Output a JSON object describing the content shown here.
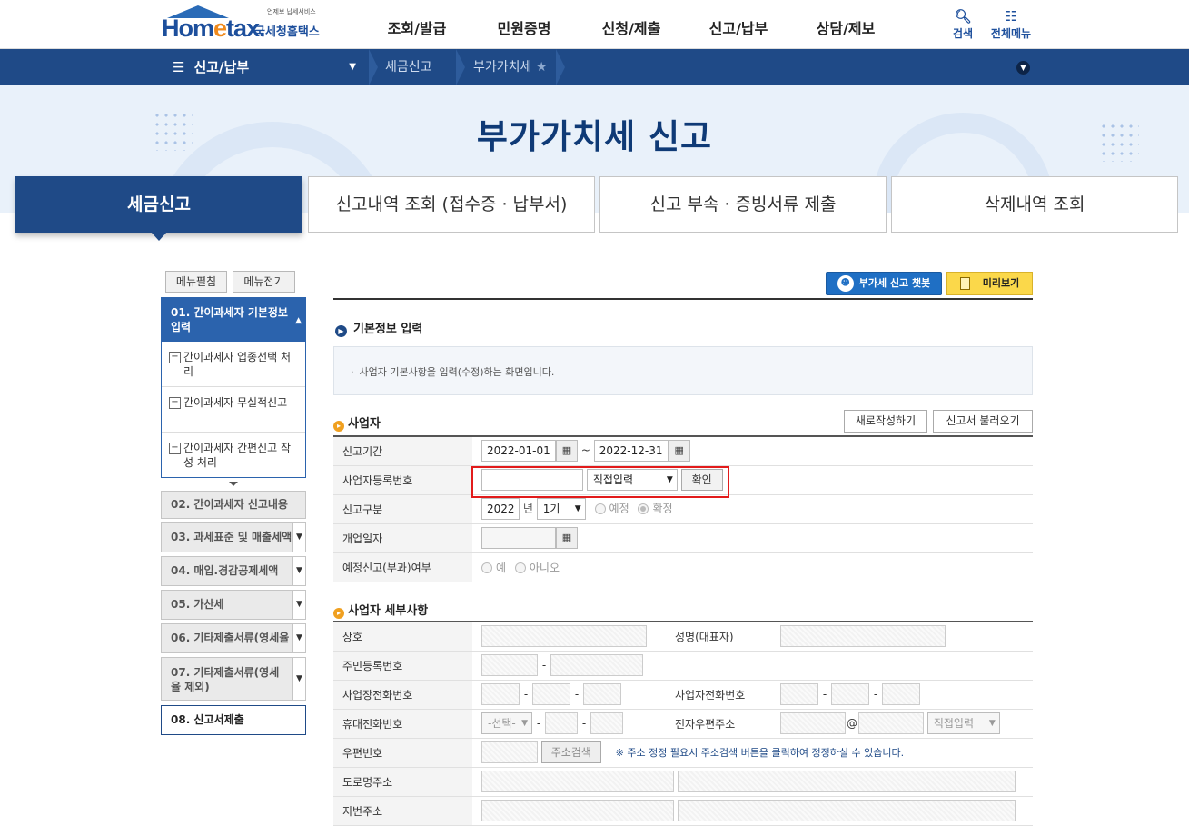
{
  "header": {
    "logo_tagline": "언제보 납세서비스",
    "logo_brand_pre": "Hom",
    "logo_brand_e": "e",
    "logo_brand_post": "tax.",
    "logo_sub": "국세청홈택스",
    "gnb": [
      "조회/발급",
      "민원증명",
      "신청/제출",
      "신고/납부",
      "상담/제보"
    ],
    "search_label": "검색",
    "allmenu_label": "전체메뉴"
  },
  "nav": {
    "current_menu": "신고/납부",
    "crumb1": "세금신고",
    "crumb2": "부가가치세"
  },
  "hero": {
    "title": "부가가치세 신고"
  },
  "tabs": [
    "세금신고",
    "신고내역 조회 (접수증 · 납부서)",
    "신고 부속 · 증빙서류 제출",
    "삭제내역 조회"
  ],
  "side": {
    "expand_label": "메뉴펼침",
    "collapse_label": "메뉴접기",
    "step1_title": "01. 간이과세자 기본정보 입력",
    "step1_items": [
      "간이과세자 업종선택 처리",
      "간이과세자 무실적신고",
      "간이과세자 간편신고 작성 처리"
    ],
    "steps": [
      "02. 간이과세자 신고내용",
      "03. 과세표준 및 매출세액",
      "04. 매입.경감공제세액",
      "05. 가산세",
      "06. 기타제출서류(영세율",
      "07. 기타제출서류(영세율 제외)",
      "08. 신고서제출"
    ]
  },
  "content": {
    "chatbot_label": "부가세 신고 챗봇",
    "preview_label": "미리보기",
    "section_title": "기본정보 입력",
    "info_text": "사업자 기본사항을 입력(수정)하는 화면입니다.",
    "biz_title": "사업자",
    "new_btn": "새로작성하기",
    "load_btn": "신고서 불러오기",
    "rows": {
      "period_label": "신고기간",
      "period_from": "2022-01-01",
      "period_tilde": "~",
      "period_to": "2022-12-31",
      "bizno_label": "사업자등록번호",
      "bizno_value": "",
      "bizno_select": "직접입력",
      "confirm_btn": "확인",
      "type_label": "신고구분",
      "year": "2022",
      "year_unit": "년",
      "term": "1기",
      "radio_pre": "예정",
      "radio_final": "확정",
      "open_label": "개업일자",
      "open_value": "",
      "pre_label": "예정신고(부과)여부",
      "yes": "예",
      "no": "아니오"
    },
    "detail_title": "사업자 세부사항",
    "detail": {
      "name_label": "상호",
      "rep_label": "성명(대표자)",
      "rrn_label": "주민등록번호",
      "shop_tel_label": "사업장전화번호",
      "biz_tel_label": "사업자전화번호",
      "mobile_label": "휴대전화번호",
      "mobile_select": "-선택-",
      "email_label": "전자우편주소",
      "at": "@",
      "email_select": "직접입력",
      "zip_label": "우편번호",
      "addr_search_btn": "주소검색",
      "zip_note": "※ 주소 정정 필요시 주소검색 버튼을 클릭하여 정정하실 수 있습니다.",
      "road_label": "도로명주소",
      "lot_label": "지번주소",
      "dash": "-"
    }
  }
}
